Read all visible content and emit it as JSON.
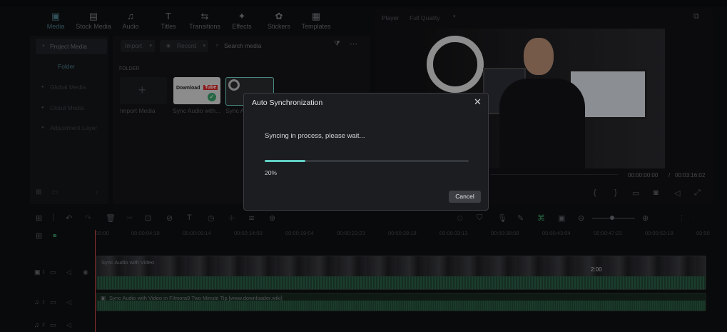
{
  "tabs": [
    {
      "label": "Media",
      "icon": "media-icon"
    },
    {
      "label": "Stock Media",
      "icon": "stock-media-icon"
    },
    {
      "label": "Audio",
      "icon": "music-note-icon"
    },
    {
      "label": "Titles",
      "icon": "text-t-icon"
    },
    {
      "label": "Transitions",
      "icon": "transition-icon"
    },
    {
      "label": "Effects",
      "icon": "effects-icon"
    },
    {
      "label": "Stickers",
      "icon": "sticker-icon"
    },
    {
      "label": "Templates",
      "icon": "template-icon"
    }
  ],
  "sidebar": {
    "items": [
      {
        "label": "Project Media"
      },
      {
        "label": "Folder"
      },
      {
        "label": "Global Media"
      },
      {
        "label": "Cloud Media"
      },
      {
        "label": "Adjustment Layer"
      }
    ]
  },
  "media": {
    "import_label": "Import",
    "record_label": "Record",
    "search_placeholder": "Search media",
    "folder_heading": "FOLDER",
    "items": [
      {
        "label": "Import Media"
      },
      {
        "label": "Sync Audio with..."
      },
      {
        "label": "Sync A"
      }
    ],
    "thumb_text_1": "Download",
    "thumb_text_2": "Tube"
  },
  "player": {
    "label": "Player",
    "quality": "Full Quality",
    "time_current": "00:00:00:00",
    "time_sep": "/",
    "time_total": "00:03:16:02"
  },
  "timeline": {
    "ticks": [
      "00:00",
      "00:00:04:19",
      "00:00:09:14",
      "00:00:14:09",
      "00:00:19:04",
      "00:00:23:23",
      "00:00:28:18",
      "00:00:33:13",
      "00:00:38:08",
      "00:00:43:04",
      "00:00:47:23",
      "00:00:52:18",
      "00:00"
    ],
    "video_clip_label": "Sync Audio with Video",
    "video_clip_badge": "2:00",
    "audio_clip_label": "Sync Audio with Video in Filmora9 Two Minute Tip [www.downloader.wiki]",
    "track_labels": [
      "1",
      "1",
      "2"
    ]
  },
  "dialog": {
    "title": "Auto Synchronization",
    "message": "Syncing in process, please wait...",
    "progress": 0.2,
    "progress_label": "20%",
    "cancel_label": "Cancel"
  },
  "colors": {
    "accent": "#5fd0c2",
    "active_tab": "#4a7a86"
  }
}
